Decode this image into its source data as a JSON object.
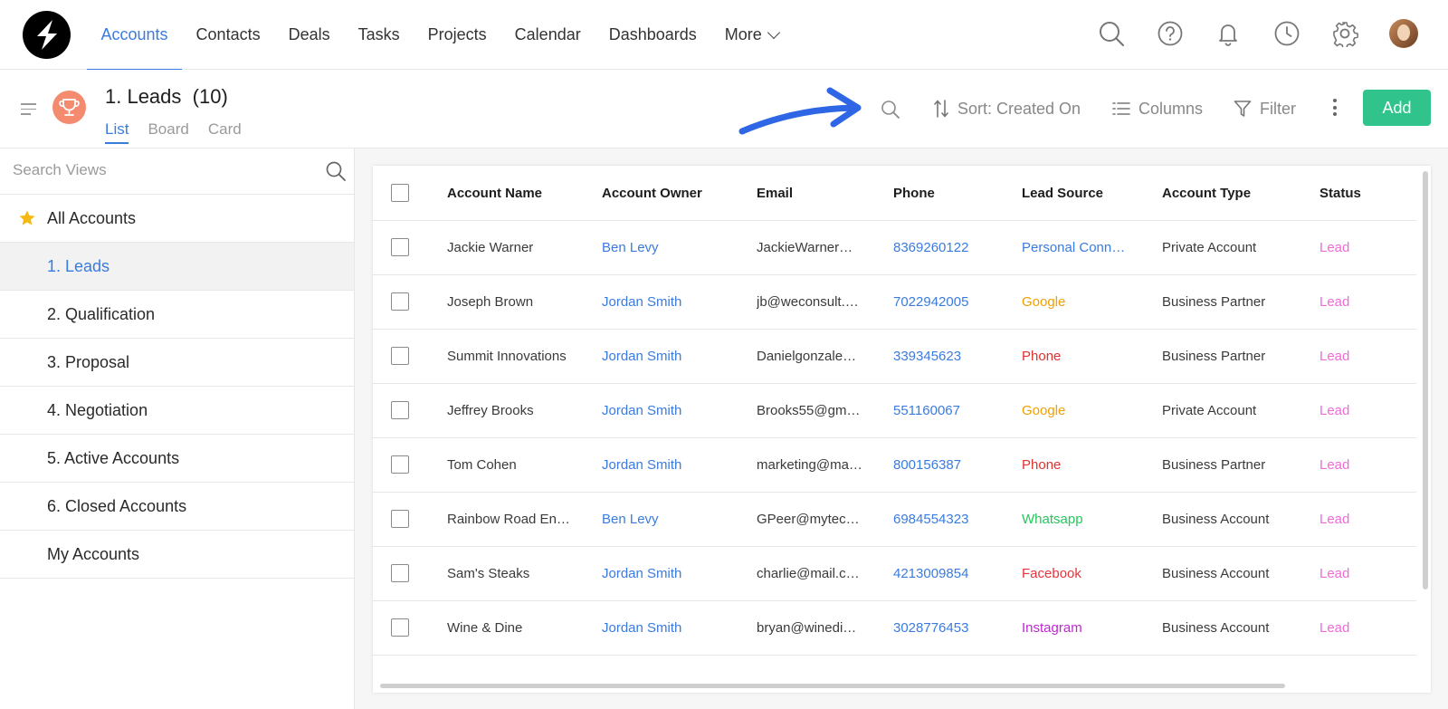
{
  "nav": {
    "items": [
      {
        "label": "Accounts",
        "active": true
      },
      {
        "label": "Contacts",
        "active": false
      },
      {
        "label": "Deals",
        "active": false
      },
      {
        "label": "Tasks",
        "active": false
      },
      {
        "label": "Projects",
        "active": false
      },
      {
        "label": "Calendar",
        "active": false
      },
      {
        "label": "Dashboards",
        "active": false
      }
    ],
    "more_label": "More"
  },
  "header": {
    "title": "1. Leads",
    "count": "(10)",
    "view_tabs": [
      {
        "label": "List",
        "active": true
      },
      {
        "label": "Board",
        "active": false
      },
      {
        "label": "Card",
        "active": false
      }
    ],
    "sort_label": "Sort: Created On",
    "columns_label": "Columns",
    "filter_label": "Filter",
    "add_label": "Add"
  },
  "sidebar": {
    "search_placeholder": "Search Views",
    "items": [
      {
        "label": "All Accounts",
        "starred": true,
        "active": false
      },
      {
        "label": "1. Leads",
        "starred": false,
        "active": true
      },
      {
        "label": "2. Qualification",
        "starred": false,
        "active": false
      },
      {
        "label": "3. Proposal",
        "starred": false,
        "active": false
      },
      {
        "label": "4. Negotiation",
        "starred": false,
        "active": false
      },
      {
        "label": "5. Active Accounts",
        "starred": false,
        "active": false
      },
      {
        "label": "6. Closed Accounts",
        "starred": false,
        "active": false
      },
      {
        "label": "My Accounts",
        "starred": false,
        "active": false
      }
    ]
  },
  "table": {
    "columns": [
      "Account Name",
      "Account Owner",
      "Email",
      "Phone",
      "Lead Source",
      "Account Type",
      "Status"
    ],
    "rows": [
      {
        "name": "Jackie Warner",
        "owner": "Ben Levy",
        "email": "JackieWarner…",
        "phone": "8369260122",
        "source": "Personal Conn…",
        "source_color": "#3a7be0",
        "type": "Private Account",
        "status": "Lead"
      },
      {
        "name": "Joseph Brown",
        "owner": "Jordan Smith",
        "email": "jb@weconsult.…",
        "phone": "7022942005",
        "source": "Google",
        "source_color": "#f0a000",
        "type": "Business Partner",
        "status": "Lead"
      },
      {
        "name": "Summit Innovations",
        "owner": "Jordan Smith",
        "email": "Danielgonzale…",
        "phone": "339345623",
        "source": "Phone",
        "source_color": "#e0312f",
        "type": "Business Partner",
        "status": "Lead"
      },
      {
        "name": "Jeffrey Brooks",
        "owner": "Jordan Smith",
        "email": "Brooks55@gm…",
        "phone": "551160067",
        "source": "Google",
        "source_color": "#f0a000",
        "type": "Private Account",
        "status": "Lead"
      },
      {
        "name": "Tom Cohen",
        "owner": "Jordan Smith",
        "email": "marketing@ma…",
        "phone": "800156387",
        "source": "Phone",
        "source_color": "#e0312f",
        "type": "Business Partner",
        "status": "Lead"
      },
      {
        "name": "Rainbow Road En…",
        "owner": "Ben Levy",
        "email": "GPeer@mytec…",
        "phone": "6984554323",
        "source": "Whatsapp",
        "source_color": "#22c95a",
        "type": "Business Account",
        "status": "Lead"
      },
      {
        "name": "Sam's Steaks",
        "owner": "Jordan Smith",
        "email": "charlie@mail.c…",
        "phone": "4213009854",
        "source": "Facebook",
        "source_color": "#e8333a",
        "type": "Business Account",
        "status": "Lead"
      },
      {
        "name": "Wine & Dine",
        "owner": "Jordan Smith",
        "email": "bryan@winedi…",
        "phone": "3028776453",
        "source": "Instagram",
        "source_color": "#c026d3",
        "type": "Business Account",
        "status": "Lead"
      }
    ],
    "status_color": "#f06ad8"
  },
  "colors": {
    "accent": "#3a7be0",
    "add_button": "#31c38c",
    "annotation_arrow": "#2e66e6"
  },
  "icons": [
    "logo-icon",
    "search-icon",
    "help-icon",
    "bell-icon",
    "clock-icon",
    "gear-icon",
    "trophy-icon",
    "sort-icon",
    "columns-icon",
    "filter-icon",
    "kebab-icon",
    "star-icon"
  ]
}
